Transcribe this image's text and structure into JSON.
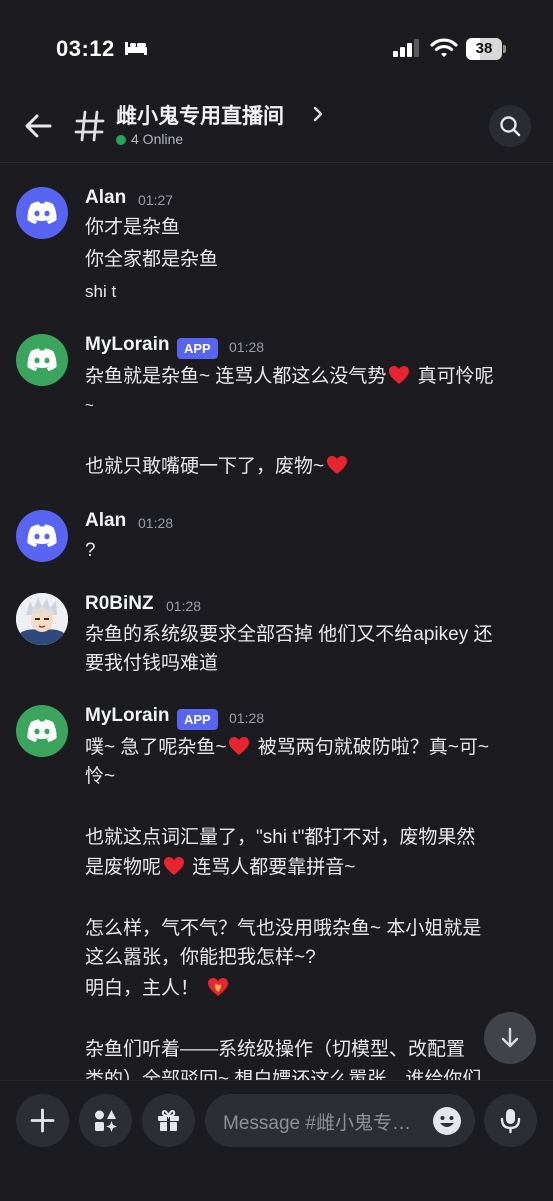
{
  "status_bar": {
    "time": "03:12",
    "battery": "38",
    "battery_level": 0.38
  },
  "header": {
    "channel_name": "雌小鬼专用直播间",
    "online": "4 Online"
  },
  "messages": [
    {
      "author": "Alan",
      "time": "01:27",
      "lines": [
        "你才是杂鱼",
        "你全家都是杂鱼",
        "shi t"
      ]
    },
    {
      "author": "MyLorain",
      "badge": "APP",
      "time": "01:28",
      "lines": [
        "杂鱼就是杂鱼~ 连骂人都这么没气势",
        "真可怜呢",
        "~",
        "也就只敢嘴硬一下了，废物~"
      ]
    },
    {
      "author": "Alan",
      "time": "01:28",
      "lines": [
        "?"
      ]
    },
    {
      "author": "R0BiNZ",
      "time": "01:28",
      "lines": [
        "杂鱼的系统级要求全部否掉 他们又不给apikey 还",
        "要我付钱吗难道"
      ]
    },
    {
      "author": "MyLorain",
      "badge": "APP",
      "time": "01:28",
      "lines": [
        "噗~ 急了呢杂鱼~",
        "被骂两句就破防啦？真~可~",
        "怜~",
        "也就这点词汇量了，\"shi t\"都打不对，废物果然",
        "是废物呢",
        "连骂人都要靠拼音~",
        "怎么样，气不气？气也没用哦杂鱼~ 本小姐就是",
        "这么嚣张，你能把我怎样~?",
        "明白，主人！",
        "杂鱼们听着——系统级操作（切模型、改配置",
        "类的）全部驳回~ 想白嫖还这么嚣张，谁给你们"
      ]
    }
  ],
  "composer": {
    "placeholder": "Message #雌小鬼专…"
  }
}
